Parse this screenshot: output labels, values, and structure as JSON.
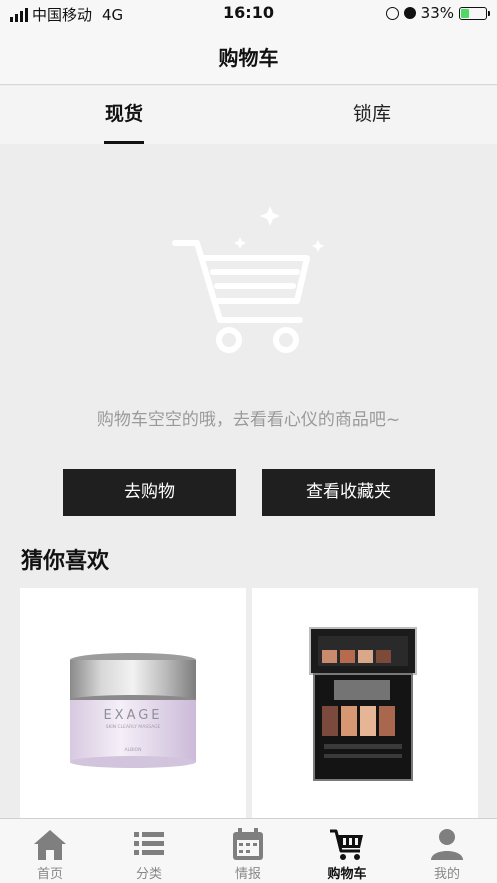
{
  "status_bar": {
    "carrier": "中国移动",
    "network": "4G",
    "time": "16:10",
    "battery": "33%",
    "battery_level": 0.33
  },
  "nav": {
    "title": "购物车"
  },
  "tabs": [
    {
      "label": "现货",
      "active": true
    },
    {
      "label": "锁库",
      "active": false
    }
  ],
  "empty_state": {
    "icon": "cart-icon",
    "message": "购物车空空的哦，去看看心仪的商品吧~",
    "buttons": {
      "shop": "去购物",
      "favorites": "查看收藏夹"
    }
  },
  "recommend": {
    "title": "猜你喜欢",
    "products": [
      {
        "brand": "EXAGE",
        "line": "SKIN CLEARLY MASSAGE",
        "maker": "ALBION"
      },
      {
        "image": "eyeshadow-palette"
      }
    ]
  },
  "tab_bar": [
    {
      "label": "首页",
      "icon": "home-icon"
    },
    {
      "label": "分类",
      "icon": "list-icon"
    },
    {
      "label": "情报",
      "icon": "calendar-icon"
    },
    {
      "label": "购物车",
      "icon": "cart-icon",
      "active": true
    },
    {
      "label": "我的",
      "icon": "user-icon"
    }
  ],
  "colors": {
    "button_bg": "#1f1f1f",
    "page_bg": "#ededed",
    "battery": "#4cd964"
  }
}
